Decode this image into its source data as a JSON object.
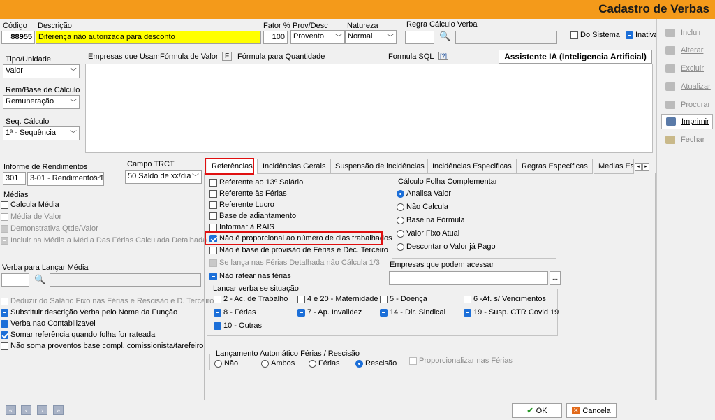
{
  "window_title": "Cadastro de Verbas",
  "header": {
    "codigo_label": "Código",
    "codigo_value": "88955",
    "descricao_label": "Descrição",
    "descricao_value": "Diferença não autorizada para desconto",
    "fator_label": "Fator %",
    "fator_value": "100",
    "provdesc_label": "Prov/Desc",
    "provdesc_value": "Provento",
    "natureza_label": "Natureza",
    "natureza_value": "Normal",
    "regra_label": "Regra Cálculo Verba",
    "do_sistema_label": "Do Sistema",
    "inativa_label": "Inativa"
  },
  "left_top": {
    "tipo_label": "Tipo/Unidade",
    "tipo_value": "Valor",
    "rem_label": "Rem/Base de Cálculo",
    "rem_value": "Remuneração",
    "seq_label": "Seq. Cálculo",
    "seq_value": "1ª - Sequência"
  },
  "formula_tabs": [
    "Empresas que Usam",
    "Fórmula de Valor",
    "F",
    "Fórmula para Quantidade",
    "Formula SQL",
    "[?]"
  ],
  "assistente_label": "Assistente IA (Inteligencia Artificial)",
  "side_buttons": [
    "Incluir",
    "Alterar",
    "Excluir",
    "Atualizar",
    "Procurar",
    "Imprimir",
    "Fechar"
  ],
  "informe": {
    "label": "Informe de Rendimentos",
    "code": "301",
    "value": "3-01 - Rendimentos Tr"
  },
  "trct": {
    "label": "Campo TRCT",
    "value": "50 Saldo de xx/dia"
  },
  "medias": {
    "label": "Médias",
    "items": [
      "Calcula Média",
      "Média de Valor",
      "Demonstrativa Qtde/Valor",
      "Incluir na Média a Média Das Férias Calculada Detalhada"
    ]
  },
  "verba_media_label": "Verba para Lançar Média",
  "left_checks": [
    "Deduzir do Salário Fixo nas  Férias e Rescisão e D. Terceiro",
    "Substituir descrição Verba pelo Nome da Função",
    "Verba nao Contabilizavel",
    "Somar referência quando folha for rateada",
    "Não soma proventos base compl. comissionista/tarefeiro"
  ],
  "tabs": [
    "Referências",
    "Incidências Gerais",
    "Suspensão de incidências",
    "Incidências Especificas",
    "Regras Específicas",
    "Medias Es"
  ],
  "ref_checks": [
    "Referente ao 13º Salário",
    "Referente às Férias",
    "Referente Lucro",
    "Base de adiantamento",
    "Informar à RAIS",
    "Não é proporcional ao número de dias trabalhados",
    "Não é base de provisão de Férias e Déc. Terceiro",
    "Se lança nas Férias Detalhada não Cálcula 1/3",
    "Não ratear nas férias"
  ],
  "calc_folha": {
    "label": "Cálculo Folha Complementar",
    "options": [
      "Analisa Valor",
      "Não Calcula",
      "Base na Fórmula",
      "Valor Fixo Atual",
      "Descontar o Valor já Pago"
    ],
    "selected": "Analisa Valor"
  },
  "empresas_label": "Empresas que podem acessar",
  "lancar_situacao": {
    "label": "Lancar verba se situação",
    "items": [
      "2 - Ac. de Trabalho",
      "4 e 20 - Maternidade",
      "5 - Doença",
      "6 -Af. s/ Vencimentos",
      "8 - Férias",
      "7 - Ap. Invalidez",
      "14  - Dir. Sindical",
      "19 - Susp. CTR Covid 19",
      "10 - Outras"
    ]
  },
  "lanc_auto": {
    "label": "Lançamento Automático Férias / Rescisão",
    "options": [
      "Não",
      "Ambos",
      "Férias",
      "Rescisão"
    ],
    "selected": "Rescisão"
  },
  "proporcionalizar_label": "Proporcionalizar nas Férias",
  "footer": {
    "ok": "OK",
    "cancel": "Cancela"
  },
  "colors": {
    "title_bar": "#f49a1a",
    "accent": "#1c6fd8",
    "highlight": "#ffff00",
    "red_box": "#e01010"
  }
}
